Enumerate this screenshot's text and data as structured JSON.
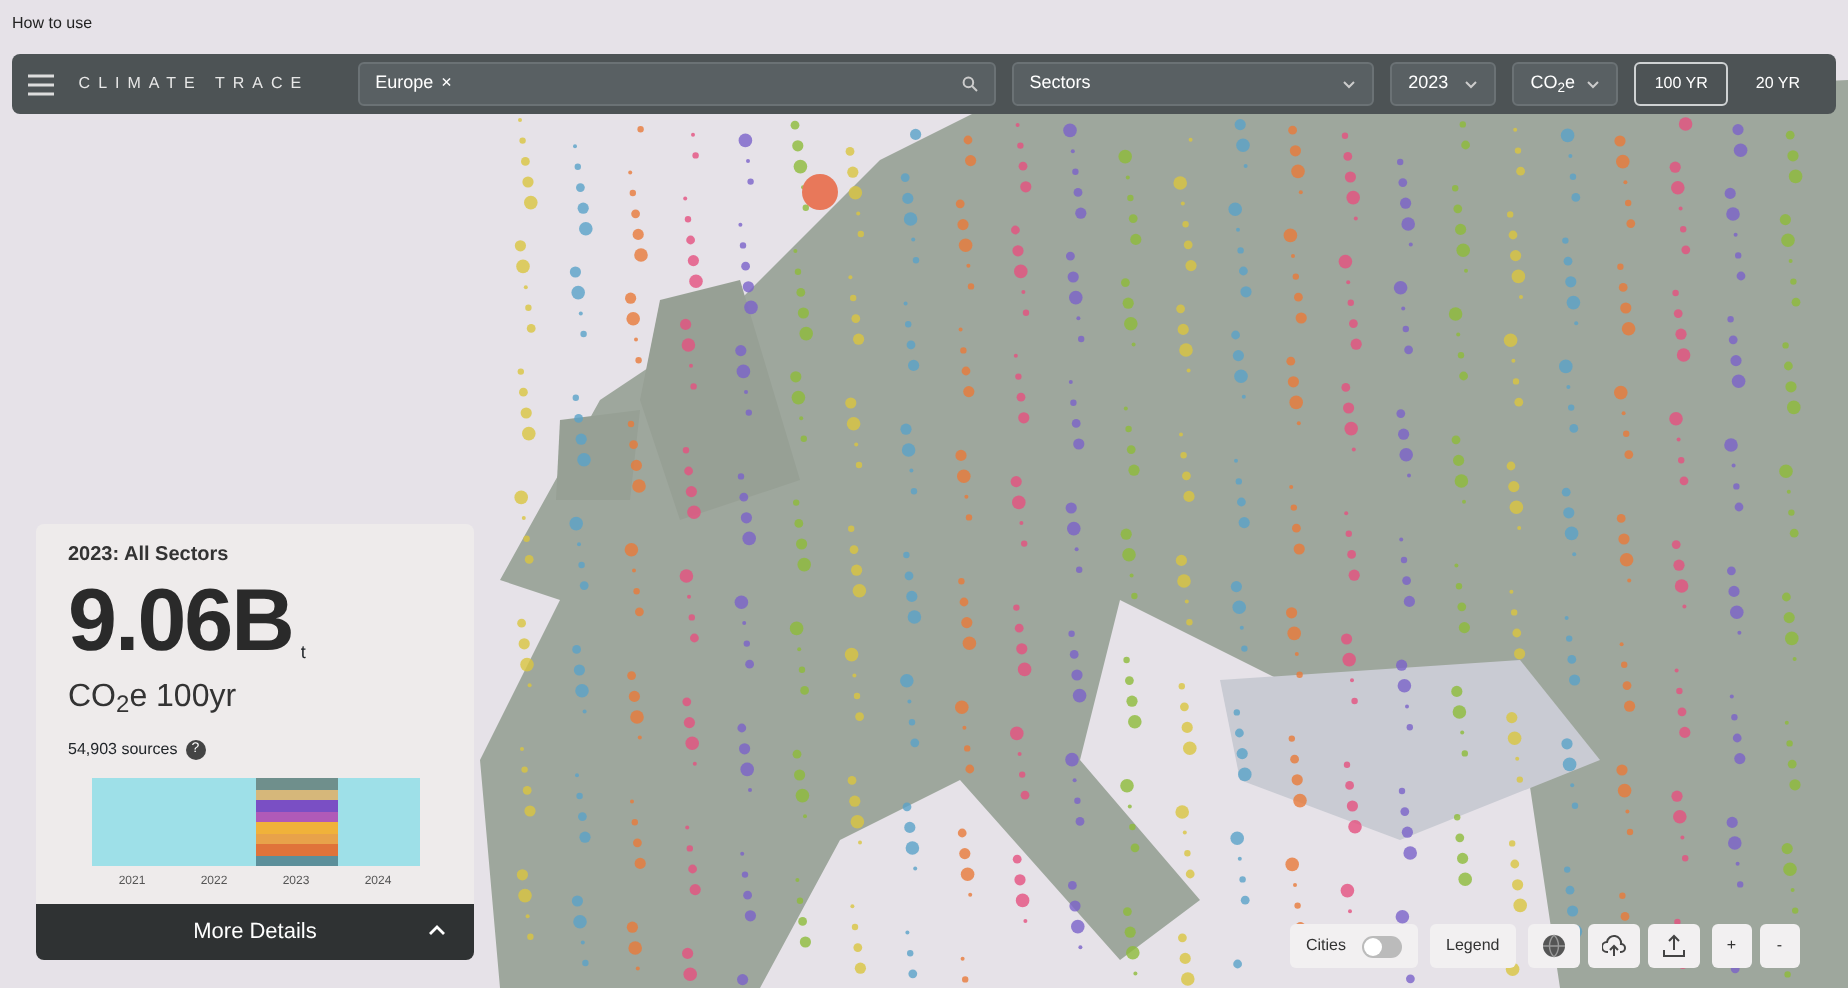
{
  "help_link": "How to use",
  "toolbar": {
    "logo": "CLIMATE TRACE",
    "region_tag": "Europe",
    "region_remove": "×",
    "sector_select": "Sectors",
    "year_select": "2023",
    "gas_select": "CO$_{2}$e",
    "horizons": [
      {
        "label": "100 YR",
        "selected": true
      },
      {
        "label": "20 YR",
        "selected": false
      }
    ]
  },
  "summary": {
    "title": "2023: All Sectors",
    "value": "9.06B",
    "unit": "t",
    "metric": "CO$_{2}$e 100yr",
    "sources": "54,903 sources",
    "help": "?",
    "years": [
      {
        "label": "2021",
        "selected": false
      },
      {
        "label": "2022",
        "selected": false
      },
      {
        "label": "2023",
        "selected": true
      },
      {
        "label": "2024",
        "selected": false
      }
    ],
    "details_button": "More Details"
  },
  "map_controls": {
    "cities_label": "Cities",
    "cities_on": false,
    "legend": "Legend",
    "zoom_in": "+",
    "zoom_out": "-"
  }
}
